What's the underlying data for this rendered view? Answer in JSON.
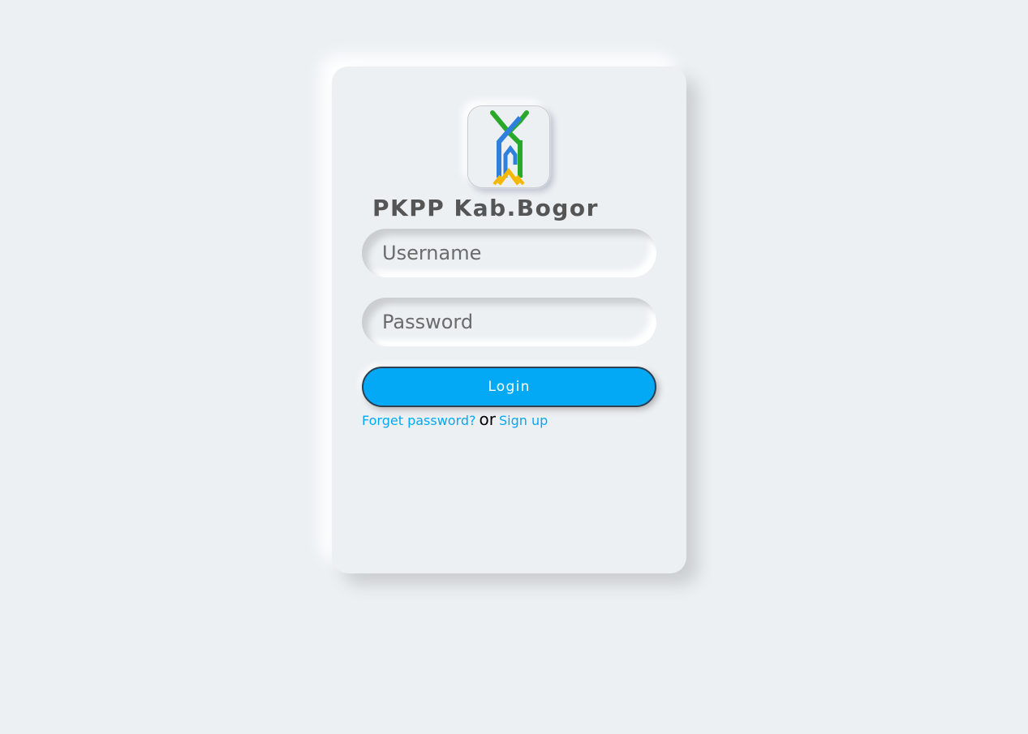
{
  "app": {
    "title": "PKPP Kab.Bogor",
    "logo_icon": "pkpp-logo-icon"
  },
  "form": {
    "username_placeholder": "Username",
    "password_placeholder": "Password",
    "login_label": "Login",
    "forgot_label": "Forget password?",
    "or_label": "or",
    "signup_label": "Sign up"
  },
  "colors": {
    "background": "#ecf0f3",
    "accent": "#03a9f4",
    "title": "#555555"
  }
}
